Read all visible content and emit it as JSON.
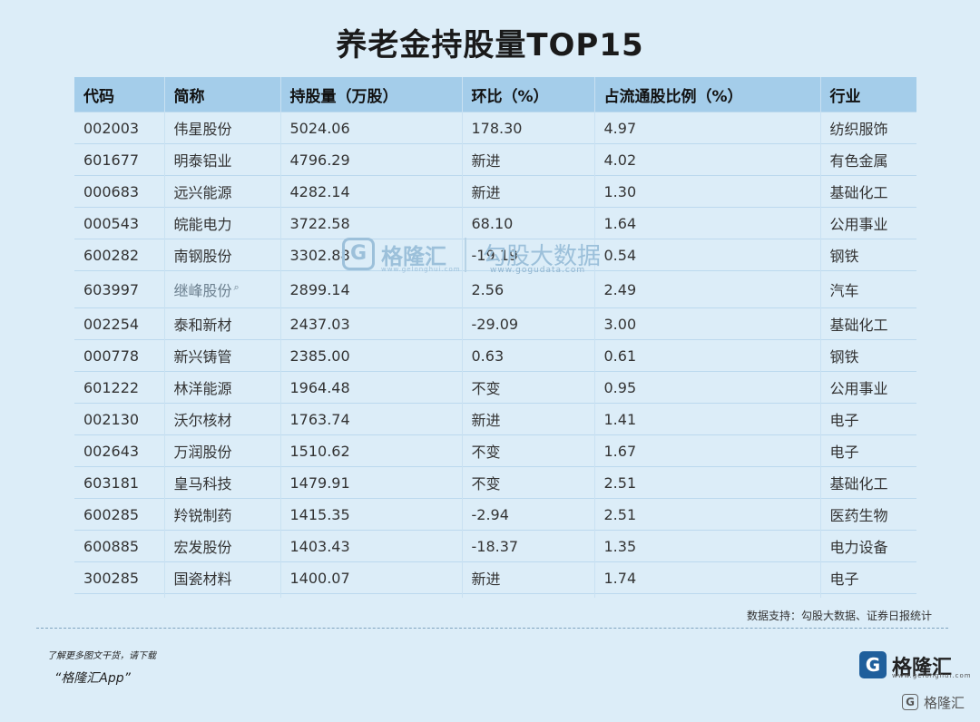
{
  "title": "养老金持股量TOP15",
  "chart_data": {
    "type": "table",
    "columns": [
      "代码",
      "简称",
      "持股量（万股）",
      "环比（%）",
      "占流通股比例（%）",
      "行业"
    ],
    "rows": [
      [
        "002003",
        "伟星股份",
        "5024.06",
        "178.30",
        "4.97",
        "纺织服饰"
      ],
      [
        "601677",
        "明泰铝业",
        "4796.29",
        "新进",
        "4.02",
        "有色金属"
      ],
      [
        "000683",
        "远兴能源",
        "4282.14",
        "新进",
        "1.30",
        "基础化工"
      ],
      [
        "000543",
        "皖能电力",
        "3722.58",
        "68.10",
        "1.64",
        "公用事业"
      ],
      [
        "600282",
        "南钢股份",
        "3302.88",
        "-19.19",
        "0.54",
        "钢铁"
      ],
      [
        "603997",
        "继峰股份",
        "2899.14",
        "2.56",
        "2.49",
        "汽车"
      ],
      [
        "002254",
        "泰和新材",
        "2437.03",
        "-29.09",
        "3.00",
        "基础化工"
      ],
      [
        "000778",
        "新兴铸管",
        "2385.00",
        "0.63",
        "0.61",
        "钢铁"
      ],
      [
        "601222",
        "林洋能源",
        "1964.48",
        "不变",
        "0.95",
        "公用事业"
      ],
      [
        "002130",
        "沃尔核材",
        "1763.74",
        "新进",
        "1.41",
        "电子"
      ],
      [
        "002643",
        "万润股份",
        "1510.62",
        "不变",
        "1.67",
        "电子"
      ],
      [
        "603181",
        "皇马科技",
        "1479.91",
        "不变",
        "2.51",
        "基础化工"
      ],
      [
        "600285",
        "羚锐制药",
        "1415.35",
        "-2.94",
        "2.51",
        "医药生物"
      ],
      [
        "600885",
        "宏发股份",
        "1403.43",
        "-18.37",
        "1.35",
        "电力设备"
      ],
      [
        "300285",
        "国瓷材料",
        "1400.07",
        "新进",
        "1.74",
        "电子"
      ]
    ],
    "link_row": 5
  },
  "watermark": {
    "logo_letter": "G",
    "brand": "格隆汇",
    "brand_url": "www.gelonghui.com",
    "second": "勾股大数据",
    "second_url": "www.gogudata.com"
  },
  "source": "数据支持：勾股大数据、证券日报统计",
  "promo": {
    "line1": "了解更多图文干货，请下载",
    "line2": "“格隆汇App”"
  },
  "logo": {
    "letter": "G",
    "brand": "格隆汇",
    "url": "www.gelonghui.com"
  },
  "corner": {
    "letter": "G",
    "text": "格隆汇"
  },
  "icons": {
    "search": "search-icon"
  }
}
